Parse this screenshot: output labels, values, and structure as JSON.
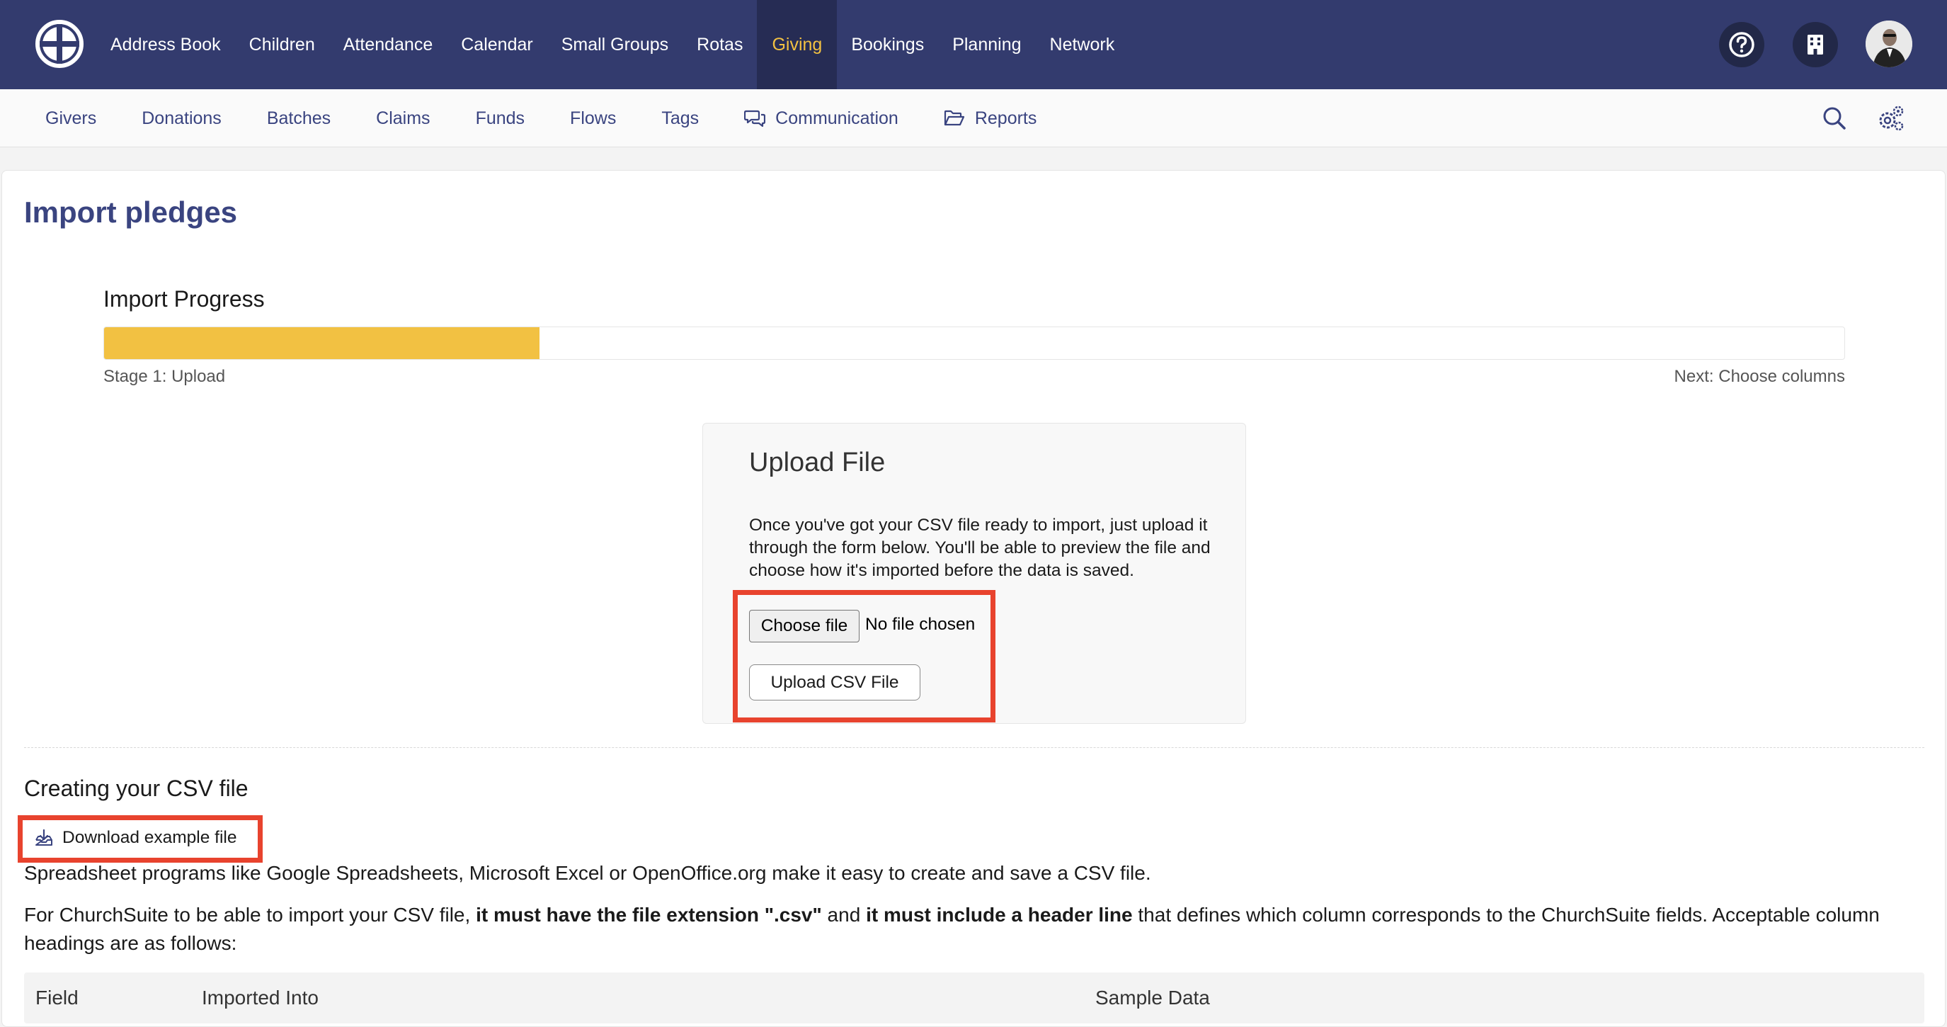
{
  "topnav": {
    "items": [
      "Address Book",
      "Children",
      "Attendance",
      "Calendar",
      "Small Groups",
      "Rotas",
      "Giving",
      "Bookings",
      "Planning",
      "Network"
    ],
    "active": "Giving",
    "icons": [
      "help-circle-icon",
      "building-icon",
      "user-avatar"
    ]
  },
  "subnav": {
    "givers": "Givers",
    "donations": "Donations",
    "batches": "Batches",
    "claims": "Claims",
    "funds": "Funds",
    "flows": "Flows",
    "tags": "Tags",
    "communication": "Communication",
    "reports": "Reports"
  },
  "page": {
    "title": "Import pledges"
  },
  "progress": {
    "heading": "Import Progress",
    "fraction": 0.25,
    "stage_label": "Stage 1: Upload",
    "next_label": "Next: Choose columns"
  },
  "upload": {
    "title": "Upload File",
    "description": "Once you've got your CSV file ready to import, just upload it through the form below. You'll be able to preview the file and choose how it's imported before the data is saved.",
    "choose_label": "Choose file",
    "no_file_text": "No file chosen",
    "submit_label": "Upload CSV File"
  },
  "csv_section": {
    "heading": "Creating your CSV file",
    "download_label": "Download example file",
    "para1": "Spreadsheet programs like Google Spreadsheets, Microsoft Excel or OpenOffice.org make it easy to create and save a CSV file.",
    "para2_a": "For ChurchSuite to be able to import your CSV file, ",
    "para2_b": "it must have the file extension \".csv\"",
    "para2_c": " and ",
    "para2_d": "it must include a header line",
    "para2_e": " that defines which column corresponds to the ChurchSuite fields. Acceptable column headings are as follows:"
  },
  "table": {
    "columns": [
      "Field",
      "Imported Into",
      "Sample Data"
    ]
  },
  "colors": {
    "nav_bg": "#333b6e",
    "accent_yellow": "#f2c142",
    "link_blue": "#3a4480",
    "highlight_red": "#e8432e"
  }
}
